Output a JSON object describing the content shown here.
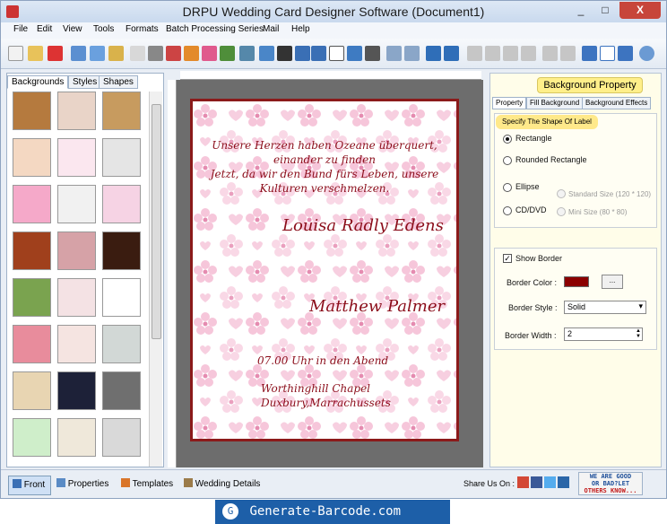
{
  "window": {
    "title": "DRPU Wedding Card Designer Software (Document1)",
    "minimize": "_",
    "maximize": "□",
    "close": "X"
  },
  "menu": [
    "File",
    "Edit",
    "View",
    "Tools",
    "Formats",
    "Batch Processing Series",
    "Mail",
    "Help"
  ],
  "left_tabs": [
    "Backgrounds",
    "Styles",
    "Shapes"
  ],
  "card": {
    "line1": "Unsere Herzen haben Ozeane überquert,",
    "line2": "einander zu finden",
    "line3": "Jetzt, da wir den Bund fürs Leben, unsere",
    "line4": "Kulturen verschmelzen.",
    "bride": "Louisa Radly Edens",
    "groom": "Matthew Palmer",
    "time": "07.00 Uhr in den Abend",
    "venue1": "Worthinghill Chapel",
    "venue2": "Duxbury,Marrachussets",
    "border_color": "#8b1a1a",
    "text_color": "#8b0d1a"
  },
  "right": {
    "heading": "Background Property",
    "tabs": [
      "Property",
      "Fill Background",
      "Background Effects"
    ],
    "shape_title": "Specify The Shape Of Label",
    "shapes": [
      "Rectangle",
      "Rounded Rectangle",
      "Ellipse",
      "CD/DVD"
    ],
    "sizes": [
      "Standard Size (120 * 120)",
      "Mini Size (80 * 80)"
    ],
    "show_border": "Show Border",
    "border_color_label": "Border Color :",
    "border_color": "#8b0000",
    "browse": "...",
    "border_style_label": "Border Style :",
    "border_style": "Solid",
    "border_width_label": "Border Width :",
    "border_width": "2"
  },
  "bottom": {
    "tabs": [
      "Front",
      "Properties",
      "Templates",
      "Wedding Details"
    ],
    "share": "Share Us On :",
    "feedback1": "WE ARE GOOD",
    "feedback2": "OR BAD?LET",
    "feedback3": "OTHERS KNOW..."
  },
  "banner": "Generate-Barcode.com"
}
